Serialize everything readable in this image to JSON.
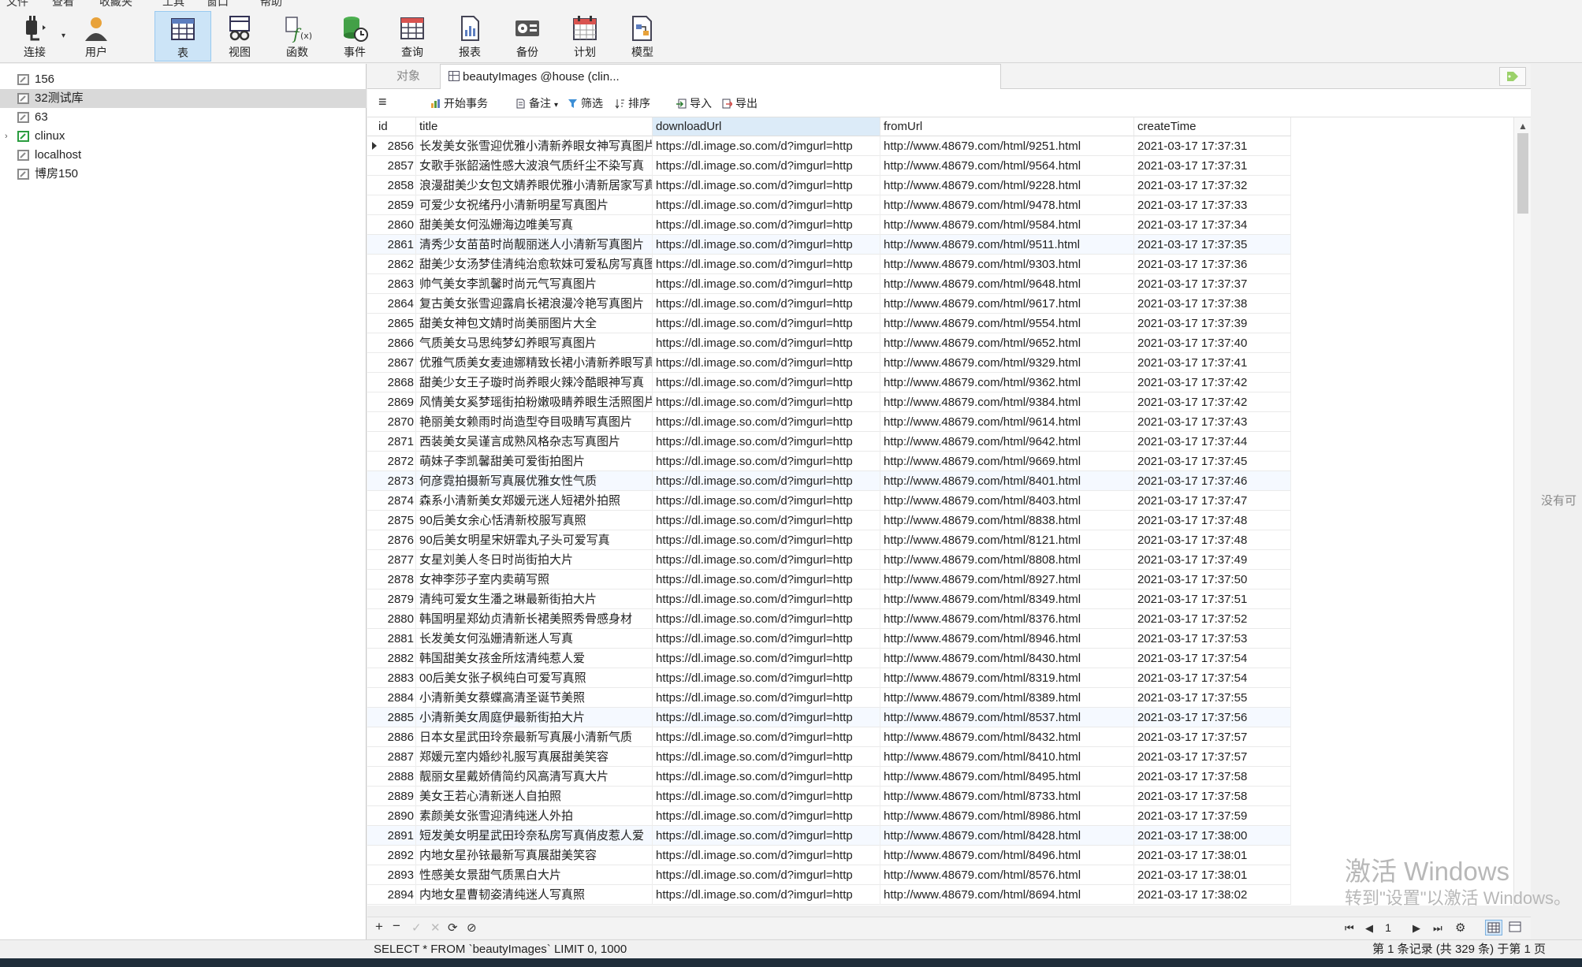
{
  "menu": [
    "文件",
    "查看",
    "收藏夹",
    "工具",
    "窗口",
    "帮助"
  ],
  "toolbar": [
    {
      "label": "连接",
      "icon": "plug-icon"
    },
    {
      "label": "用户",
      "icon": "user-icon"
    },
    {
      "label": "表",
      "icon": "table-icon",
      "active": true
    },
    {
      "label": "视图",
      "icon": "view-icon"
    },
    {
      "label": "函数",
      "icon": "function-icon"
    },
    {
      "label": "事件",
      "icon": "event-icon"
    },
    {
      "label": "查询",
      "icon": "query-icon"
    },
    {
      "label": "报表",
      "icon": "report-icon"
    },
    {
      "label": "备份",
      "icon": "backup-icon"
    },
    {
      "label": "计划",
      "icon": "schedule-icon"
    },
    {
      "label": "模型",
      "icon": "model-icon"
    }
  ],
  "connections": [
    {
      "name": "156",
      "expandable": false,
      "selected": false,
      "active": false
    },
    {
      "name": "32测试库",
      "expandable": false,
      "selected": true,
      "active": false
    },
    {
      "name": "63",
      "expandable": false,
      "selected": false,
      "active": false
    },
    {
      "name": "clinux",
      "expandable": true,
      "selected": false,
      "active": true
    },
    {
      "name": "localhost",
      "expandable": false,
      "selected": false,
      "active": false
    },
    {
      "name": "博房150",
      "expandable": false,
      "selected": false,
      "active": false
    }
  ],
  "tabs": {
    "objects": "对象",
    "table": "beautyImages @house (clin..."
  },
  "subtoolbar": {
    "begin": "开始事务",
    "note": "备注",
    "filter": "筛选",
    "sort": "排序",
    "import": "导入",
    "export": "导出"
  },
  "columns": [
    "id",
    "title",
    "downloadUrl",
    "fromUrl",
    "createTime"
  ],
  "download_prefix": "https://dl.image.so.com/d?imgurl=http",
  "rows": [
    [
      "2856",
      "长发美女张雪迎优雅小清新养眼女神写真图片",
      "https://dl.image.so.com/d?imgurl=http",
      "http://www.48679.com/html/9251.html",
      "2021-03-17 17:37:31"
    ],
    [
      "2857",
      "女歌手张韶涵性感大波浪气质纤尘不染写真",
      "https://dl.image.so.com/d?imgurl=http",
      "http://www.48679.com/html/9564.html",
      "2021-03-17 17:37:31"
    ],
    [
      "2858",
      "浪漫甜美少女包文婧养眼优雅小清新居家写真",
      "https://dl.image.so.com/d?imgurl=http",
      "http://www.48679.com/html/9228.html",
      "2021-03-17 17:37:32"
    ],
    [
      "2859",
      "可爱少女祝绪丹小清新明星写真图片",
      "https://dl.image.so.com/d?imgurl=http",
      "http://www.48679.com/html/9478.html",
      "2021-03-17 17:37:33"
    ],
    [
      "2860",
      "甜美美女何泓姗海边唯美写真",
      "https://dl.image.so.com/d?imgurl=http",
      "http://www.48679.com/html/9584.html",
      "2021-03-17 17:37:34"
    ],
    [
      "2861",
      "清秀少女苗苗时尚靓丽迷人小清新写真图片",
      "https://dl.image.so.com/d?imgurl=http",
      "http://www.48679.com/html/9511.html",
      "2021-03-17 17:37:35"
    ],
    [
      "2862",
      "甜美少女汤梦佳清纯治愈软妹可爱私房写真图",
      "https://dl.image.so.com/d?imgurl=http",
      "http://www.48679.com/html/9303.html",
      "2021-03-17 17:37:36"
    ],
    [
      "2863",
      "帅气美女李凯馨时尚元气写真图片",
      "https://dl.image.so.com/d?imgurl=http",
      "http://www.48679.com/html/9648.html",
      "2021-03-17 17:37:37"
    ],
    [
      "2864",
      "复古美女张雪迎露肩长裙浪漫冷艳写真图片",
      "https://dl.image.so.com/d?imgurl=http",
      "http://www.48679.com/html/9617.html",
      "2021-03-17 17:37:38"
    ],
    [
      "2865",
      "甜美女神包文婧时尚美丽图片大全",
      "https://dl.image.so.com/d?imgurl=http",
      "http://www.48679.com/html/9554.html",
      "2021-03-17 17:37:39"
    ],
    [
      "2866",
      "气质美女马思纯梦幻养眼写真图片",
      "https://dl.image.so.com/d?imgurl=http",
      "http://www.48679.com/html/9652.html",
      "2021-03-17 17:37:40"
    ],
    [
      "2867",
      "优雅气质美女麦迪娜精致长裙小清新养眼写真",
      "https://dl.image.so.com/d?imgurl=http",
      "http://www.48679.com/html/9329.html",
      "2021-03-17 17:37:41"
    ],
    [
      "2868",
      "甜美少女王子璇时尚养眼火辣冷酷眼神写真",
      "https://dl.image.so.com/d?imgurl=http",
      "http://www.48679.com/html/9362.html",
      "2021-03-17 17:37:42"
    ],
    [
      "2869",
      "风情美女奚梦瑶街拍粉嫩吸睛养眼生活照图片",
      "https://dl.image.so.com/d?imgurl=http",
      "http://www.48679.com/html/9384.html",
      "2021-03-17 17:37:42"
    ],
    [
      "2870",
      "艳丽美女赖雨时尚造型夺目吸睛写真图片",
      "https://dl.image.so.com/d?imgurl=http",
      "http://www.48679.com/html/9614.html",
      "2021-03-17 17:37:43"
    ],
    [
      "2871",
      "西装美女吴谨言成熟风格杂志写真图片",
      "https://dl.image.so.com/d?imgurl=http",
      "http://www.48679.com/html/9642.html",
      "2021-03-17 17:37:44"
    ],
    [
      "2872",
      "萌妹子李凯馨甜美可爱街拍图片",
      "https://dl.image.so.com/d?imgurl=http",
      "http://www.48679.com/html/9669.html",
      "2021-03-17 17:37:45"
    ],
    [
      "2873",
      "何彦霓拍摄新写真展优雅女性气质",
      "https://dl.image.so.com/d?imgurl=http",
      "http://www.48679.com/html/8401.html",
      "2021-03-17 17:37:46"
    ],
    [
      "2874",
      "森系小清新美女郑媛元迷人短裙外拍照",
      "https://dl.image.so.com/d?imgurl=http",
      "http://www.48679.com/html/8403.html",
      "2021-03-17 17:37:47"
    ],
    [
      "2875",
      "90后美女余心恬清新校服写真照",
      "https://dl.image.so.com/d?imgurl=http",
      "http://www.48679.com/html/8838.html",
      "2021-03-17 17:37:48"
    ],
    [
      "2876",
      "90后美女明星宋妍霏丸子头可爱写真",
      "https://dl.image.so.com/d?imgurl=http",
      "http://www.48679.com/html/8121.html",
      "2021-03-17 17:37:48"
    ],
    [
      "2877",
      "女星刘美人冬日时尚街拍大片",
      "https://dl.image.so.com/d?imgurl=http",
      "http://www.48679.com/html/8808.html",
      "2021-03-17 17:37:49"
    ],
    [
      "2878",
      "女神李莎子室内卖萌写照",
      "https://dl.image.so.com/d?imgurl=http",
      "http://www.48679.com/html/8927.html",
      "2021-03-17 17:37:50"
    ],
    [
      "2879",
      "清纯可爱女生潘之琳最新街拍大片",
      "https://dl.image.so.com/d?imgurl=http",
      "http://www.48679.com/html/8349.html",
      "2021-03-17 17:37:51"
    ],
    [
      "2880",
      "韩国明星郑幼贞清新长裙美照秀骨感身材",
      "https://dl.image.so.com/d?imgurl=http",
      "http://www.48679.com/html/8376.html",
      "2021-03-17 17:37:52"
    ],
    [
      "2881",
      "长发美女何泓姗清新迷人写真",
      "https://dl.image.so.com/d?imgurl=http",
      "http://www.48679.com/html/8946.html",
      "2021-03-17 17:37:53"
    ],
    [
      "2882",
      "韩国甜美女孩金所炫清纯惹人爱",
      "https://dl.image.so.com/d?imgurl=http",
      "http://www.48679.com/html/8430.html",
      "2021-03-17 17:37:54"
    ],
    [
      "2883",
      "00后美女张子枫纯白可爱写真照",
      "https://dl.image.so.com/d?imgurl=http",
      "http://www.48679.com/html/8319.html",
      "2021-03-17 17:37:54"
    ],
    [
      "2884",
      "小清新美女蔡蝶高清圣诞节美照",
      "https://dl.image.so.com/d?imgurl=http",
      "http://www.48679.com/html/8389.html",
      "2021-03-17 17:37:55"
    ],
    [
      "2885",
      "小清新美女周庭伊最新街拍大片",
      "https://dl.image.so.com/d?imgurl=http",
      "http://www.48679.com/html/8537.html",
      "2021-03-17 17:37:56"
    ],
    [
      "2886",
      "日本女星武田玲奈最新写真展小清新气质",
      "https://dl.image.so.com/d?imgurl=http",
      "http://www.48679.com/html/8432.html",
      "2021-03-17 17:37:57"
    ],
    [
      "2887",
      "郑媛元室内婚纱礼服写真展甜美笑容",
      "https://dl.image.so.com/d?imgurl=http",
      "http://www.48679.com/html/8410.html",
      "2021-03-17 17:37:57"
    ],
    [
      "2888",
      "靓丽女星戴娇倩简约风高清写真大片",
      "https://dl.image.so.com/d?imgurl=http",
      "http://www.48679.com/html/8495.html",
      "2021-03-17 17:37:58"
    ],
    [
      "2889",
      "美女王若心清新迷人自拍照",
      "https://dl.image.so.com/d?imgurl=http",
      "http://www.48679.com/html/8733.html",
      "2021-03-17 17:37:58"
    ],
    [
      "2890",
      "素颜美女张雪迎清纯迷人外拍",
      "https://dl.image.so.com/d?imgurl=http",
      "http://www.48679.com/html/8986.html",
      "2021-03-17 17:37:59"
    ],
    [
      "2891",
      "短发美女明星武田玲奈私房写真俏皮惹人爱",
      "https://dl.image.so.com/d?imgurl=http",
      "http://www.48679.com/html/8428.html",
      "2021-03-17 17:38:00"
    ],
    [
      "2892",
      "内地女星孙铱最新写真展甜美笑容",
      "https://dl.image.so.com/d?imgurl=http",
      "http://www.48679.com/html/8496.html",
      "2021-03-17 17:38:01"
    ],
    [
      "2893",
      "性感美女景甜气质黑白大片",
      "https://dl.image.so.com/d?imgurl=http",
      "http://www.48679.com/html/8576.html",
      "2021-03-17 17:38:01"
    ],
    [
      "2894",
      "内地女星曹韧姿清纯迷人写真照",
      "https://dl.image.so.com/d?imgurl=http",
      "http://www.48679.com/html/8694.html",
      "2021-03-17 17:38:02"
    ]
  ],
  "pager": {
    "page": "1"
  },
  "status": {
    "sql": "SELECT * FROM `beautyImages` LIMIT 0, 1000",
    "records": "第 1 条记录 (共 329 条) 于第 1 页"
  },
  "side_text": "没有可",
  "watermark": {
    "line1": "激活 Windows",
    "line2": "转到\"设置\"以激活 Windows。"
  },
  "colors": {
    "selected_tab": "#cce4f7",
    "connection_active": "#2a9d3f",
    "highlight_header": "#dcebf8"
  }
}
